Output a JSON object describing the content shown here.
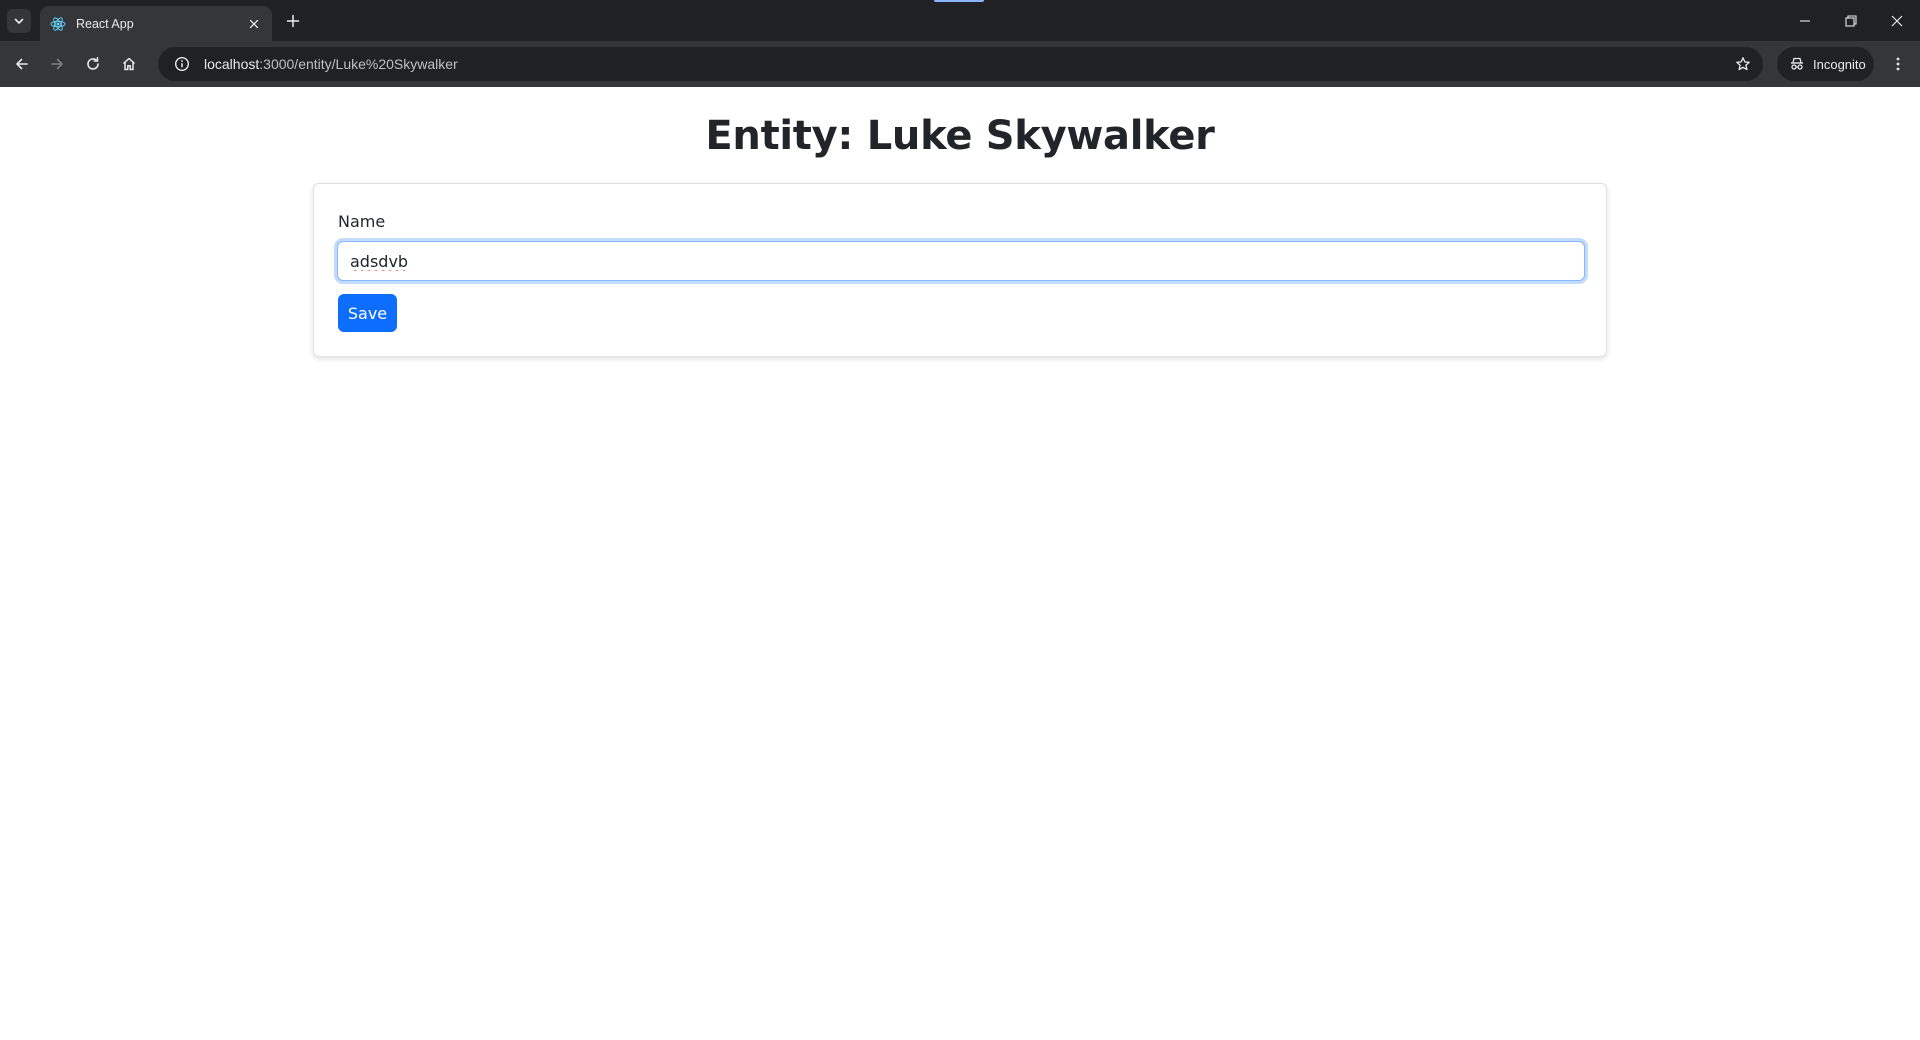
{
  "browser": {
    "tab_title": "React App",
    "url_host": "localhost",
    "url_rest": ":3000/entity/Luke%20Skywalker",
    "incognito_label": "Incognito",
    "icons": {
      "tab_search": "chevron-down-icon",
      "favicon": "react-icon",
      "tab_close": "close-icon",
      "new_tab": "plus-icon",
      "back": "arrow-left-icon",
      "forward": "arrow-right-icon",
      "reload": "reload-icon",
      "home": "home-icon",
      "site_info": "info-icon",
      "bookmark": "star-icon",
      "incognito": "incognito-icon",
      "menu": "kebab-menu-icon",
      "minimize": "minimize-icon",
      "restore": "restore-icon",
      "close_window": "close-icon"
    }
  },
  "page": {
    "title": "Entity: Luke Skywalker",
    "form": {
      "name_label": "Name",
      "name_value": "adsdvb",
      "save_label": "Save"
    }
  },
  "colors": {
    "primary": "#0d6efd",
    "text": "#212529",
    "chrome_dark": "#202124",
    "chrome_toolbar": "#35363a"
  }
}
